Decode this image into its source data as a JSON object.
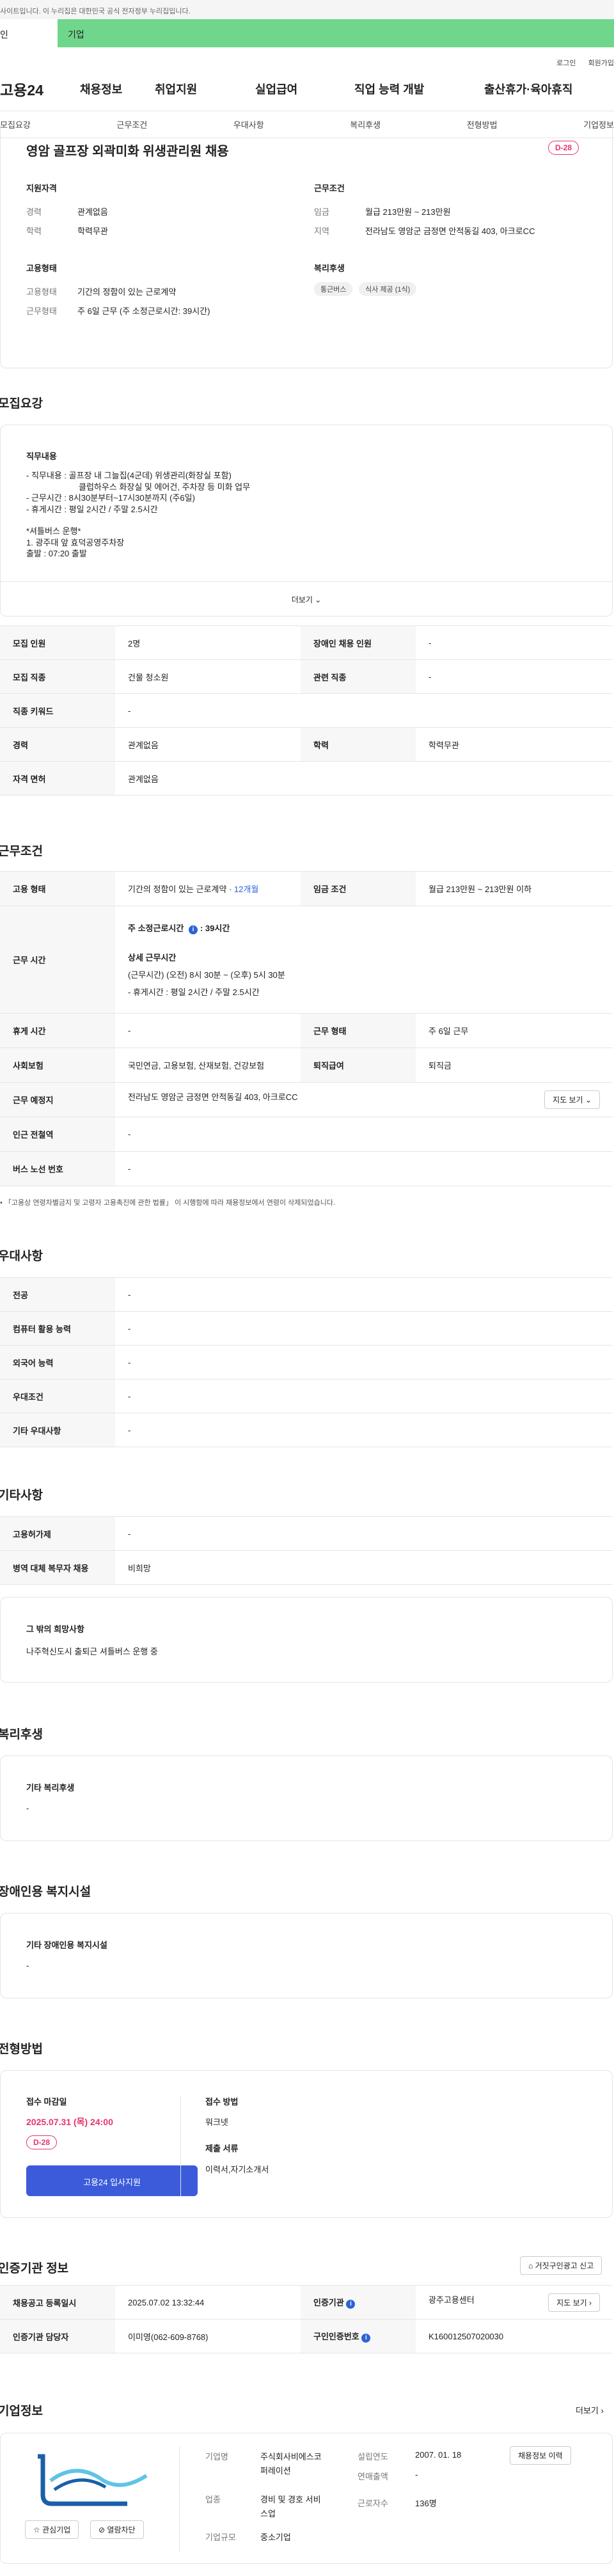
{
  "topbar": {
    "notice": "사이트입니다. 이 누리집은 대한민국 공식 전자정부 누리집입니다."
  },
  "tabs": {
    "current": "인",
    "other": "기업"
  },
  "util": {
    "login": "로그인",
    "join": "회원가입"
  },
  "gnb": {
    "logo": "고용24",
    "items": [
      "채용정보",
      "취업지원",
      "실업급여",
      "직업 능력 개발",
      "출산휴가·육아휴직"
    ]
  },
  "subnav": [
    "모집요강",
    "근무조건",
    "우대사항",
    "복리후생",
    "전형방법",
    "기업정보"
  ],
  "job": {
    "title": "영암 골프장 외곽미화 위생관리원 채용",
    "dday": "D-28",
    "qualification_heading": "지원자격",
    "career_label": "경력",
    "career": "관계없음",
    "edu_label": "학력",
    "edu": "학력무관",
    "work_heading": "근무조건",
    "wage_label": "임금",
    "wage": "월급 213만원 ~ 213만원",
    "region_label": "지역",
    "region": "전라남도 영암군 금정면 안적동길 403, 아크로CC",
    "employ_heading": "고용형태",
    "emp_type_label": "고용형태",
    "emp_type": "기간의 정함이 있는 근로계약",
    "work_form_label": "근무형태",
    "work_form": "주 6일 근무 (주 소정근로시간: 39시간)",
    "welfare_heading": "복리후생",
    "chips": [
      "통근버스",
      "식사 제공 (1식)"
    ]
  },
  "recruit": {
    "heading": "모집요강",
    "duty_heading": "직무내용",
    "duty_lines": [
      "- 직무내용 : 골프장 내 그늘집(4군데) 위생관리(화장실 포함)",
      "클럽하우스 화장실 및 에어건, 주차장 등 미화 업무",
      "- 근무시간 : 8시30분부터~17시30분까지 (주6일)",
      "- 휴게시간 : 평일 2시간 / 주말 2.5시간",
      "",
      "*셔틀버스 운행*",
      "1. 광주대 앞 효덕공영주차장",
      "출발 : 07:20 출발"
    ],
    "more": "더보기",
    "rows": [
      {
        "k1": "모집 인원",
        "v1": "2명",
        "k2": "장애인 채용 인원",
        "v2": "-"
      },
      {
        "k1": "모집 직종",
        "v1": "건물 청소원",
        "k2": "관련 직종",
        "v2": "-"
      },
      {
        "k1": "직종 키워드",
        "v1": "-"
      },
      {
        "k1": "경력",
        "v1": "관계없음",
        "k2": "학력",
        "v2": "학력무관"
      },
      {
        "k1": "자격 면허",
        "v1": "관계없음"
      }
    ]
  },
  "condition": {
    "heading": "근무조건",
    "emp_type_label": "고용 형태",
    "emp_type_text": "기간의 정함이 있는 근로계약 · ",
    "emp_type_months": "12개월",
    "wage_label": "임금 조건",
    "wage": "월급 213만원 ~ 213만원 이하",
    "work_time_label": "근무 시간",
    "weekly_hours_text": "주 소정근로시간",
    "weekly_hours": "39시간",
    "detail_heading": "상세 근무시간",
    "detail_lines": [
      "(근무시간) (오전) 8시 30분 ~ (오후) 5시 30분",
      "- 휴게시간 : 평일 2시간 / 주말 2.5시간"
    ],
    "rest_label": "휴게 시간",
    "rest": "-",
    "work_form_label": "근무 형태",
    "work_form": "주 6일 근무",
    "insurance_label": "사회보험",
    "insurance": "국민연금, 고용보험, 산재보험, 건강보험",
    "severance_label": "퇴직급여",
    "severance": "퇴직금",
    "place_label": "근무 예정지",
    "place": "전라남도 영암군 금정면 안적동길 403, 아크로CC",
    "map_btn": "지도 보기",
    "station_label": "인근 전철역",
    "station": "-",
    "bus_label": "버스 노선 번호",
    "bus": "-",
    "footnote": "「고용상 연령차별금지 및 고령자 고용촉진에 관한 법률」 이 시행함에 따라 채용정보에서 연령이 삭제되었습니다."
  },
  "preference": {
    "heading": "우대사항",
    "rows": [
      {
        "k": "전공",
        "v": "-"
      },
      {
        "k": "컴퓨터 활용 능력",
        "v": "-"
      },
      {
        "k": "외국어 능력",
        "v": "-"
      },
      {
        "k": "우대조건",
        "v": "-"
      },
      {
        "k": "기타 우대사항",
        "v": "-"
      }
    ]
  },
  "etc": {
    "heading": "기타사항",
    "rows": [
      {
        "k": "고용허가제",
        "v": "-"
      },
      {
        "k": "병역 대체 복무자 채용",
        "v": "비희망"
      }
    ],
    "hope_heading": "그 밖의 희망사항",
    "hope": "나주혁신도시 출퇴근 셔틀버스 운행 중"
  },
  "welfare": {
    "heading": "복리후생",
    "box_heading": "기타 복리후생",
    "value": "-"
  },
  "disability": {
    "heading": "장애인용 복지시설",
    "box_heading": "기타 장애인용 복지시설",
    "value": "-"
  },
  "process": {
    "heading": "전형방법",
    "deadline_label": "접수 마감일",
    "deadline": "2025.07.31 (목) 24:00",
    "dday": "D-28",
    "apply_btn": "고용24 입사지원",
    "method_label": "접수 방법",
    "method": "워크넷",
    "docs_label": "제출 서류",
    "docs": "이력서,자기소개서"
  },
  "agency": {
    "heading": "인증기관 정보",
    "report_btn": "거짓구인광고 신고",
    "reg_label": "채용공고 등록일시",
    "reg": "2025.07.02 13:32:44",
    "agency_label": "인증기관",
    "agency": "광주고용센터",
    "staff_label": "인증기관 담당자",
    "staff": "이미영(062-609-8768)",
    "map_btn": "지도 보기",
    "no_label": "구인인증번호",
    "no": "K160012507020030"
  },
  "company": {
    "heading": "기업정보",
    "more": "더보기",
    "fav_btn": "관심기업",
    "block_btn": "열람차단",
    "name_label": "기업명",
    "name_lines": [
      "주식회사비에스코",
      "퍼레이션"
    ],
    "founded_label": "설립연도",
    "founded": "2007. 01. 18",
    "sales_label": "연매출액",
    "sales": "-",
    "industry_label": "업종",
    "industry_lines": [
      "경비 및 경호 서비",
      "스업"
    ],
    "employees_label": "근로자수",
    "employees": "136명",
    "size_label": "기업규모",
    "size": "중소기업",
    "jobs_btn": "채용정보 이력"
  }
}
